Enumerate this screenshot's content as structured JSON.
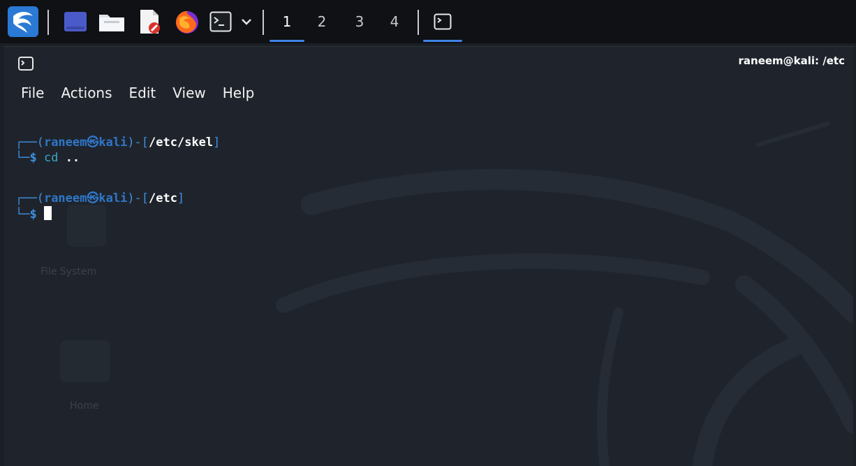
{
  "panel": {
    "workspaces": [
      "1",
      "2",
      "3",
      "4"
    ],
    "active_workspace": "1"
  },
  "window": {
    "title": "raneem@kali: /etc"
  },
  "menu": {
    "items": [
      "File",
      "Actions",
      "Edit",
      "View",
      "Help"
    ]
  },
  "terminal": {
    "prompt1": {
      "open": "┌──(",
      "user": "raneem㉿kali",
      "mid": ")-[",
      "path": "/etc/skel",
      "close": "]"
    },
    "line1": {
      "prefix": "└─",
      "dollar": "$ ",
      "cmd": "cd",
      "arg": " .."
    },
    "prompt2": {
      "open": "┌──(",
      "user": "raneem㉿kali",
      "mid": ")-[",
      "path": "/etc",
      "close": "]"
    },
    "line2": {
      "prefix": "└─",
      "dollar": "$ "
    }
  },
  "desktop": {
    "icon_labels": [
      "File System",
      "Home"
    ]
  },
  "colors": {
    "panel_bg": "#0f1114",
    "terminal_bg": "#1f242c",
    "prompt_blue": "#3f8fe0",
    "accent_underline": "#3f83e6"
  }
}
